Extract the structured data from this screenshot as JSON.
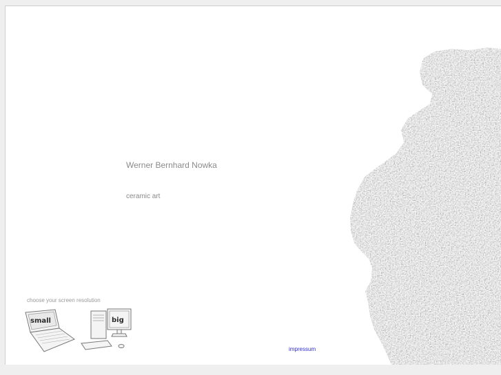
{
  "page": {
    "artist_name": "Werner Bernhard Nowka",
    "tagline": "ceramic art"
  },
  "resolution": {
    "prompt": "choose your screen resolution",
    "small_label": "small",
    "big_label": "big"
  },
  "footer": {
    "impressum_label": "impressum"
  },
  "icons": [
    "laptop-icon",
    "desktop-computer-icon"
  ],
  "colors": {
    "background": "#ffffff",
    "text_gray": "#8a8a8a",
    "link_blue": "#2e2ed6"
  }
}
